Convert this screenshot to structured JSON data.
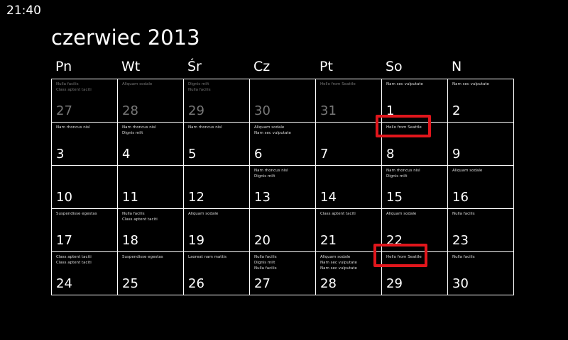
{
  "status_bar": {
    "time": "21:40"
  },
  "header": {
    "month_title": "czerwiec 2013"
  },
  "weekdays": [
    "Pn",
    "Wt",
    "Śr",
    "Cz",
    "Pt",
    "So",
    "N"
  ],
  "weeks": [
    [
      {
        "day": "27",
        "other": true,
        "events": [
          "Nulla facilis",
          "Class aptent taciti"
        ]
      },
      {
        "day": "28",
        "other": true,
        "events": [
          "Aliquam sodale"
        ]
      },
      {
        "day": "29",
        "other": true,
        "events": [
          "Dignis milt",
          "Nulla facilis"
        ]
      },
      {
        "day": "30",
        "other": true,
        "events": []
      },
      {
        "day": "31",
        "other": true,
        "events": [
          "Hello from Seattle"
        ]
      },
      {
        "day": "1",
        "other": false,
        "events": [
          "Nam sec vulputate"
        ]
      },
      {
        "day": "2",
        "other": false,
        "events": [
          "Nam sec vulputate"
        ]
      }
    ],
    [
      {
        "day": "3",
        "other": false,
        "events": [
          "Nam rhoncus nisl"
        ]
      },
      {
        "day": "4",
        "other": false,
        "events": [
          "Nam rhoncus nisl",
          "Dignis milt"
        ]
      },
      {
        "day": "5",
        "other": false,
        "events": [
          "Nam rhoncus nisl"
        ]
      },
      {
        "day": "6",
        "other": false,
        "events": [
          "Aliquam sodale",
          "Nam sec vulputate"
        ]
      },
      {
        "day": "7",
        "other": false,
        "events": []
      },
      {
        "day": "8",
        "other": false,
        "events": [
          "Hello from Seattle"
        ]
      },
      {
        "day": "9",
        "other": false,
        "events": []
      }
    ],
    [
      {
        "day": "10",
        "other": false,
        "events": []
      },
      {
        "day": "11",
        "other": false,
        "events": []
      },
      {
        "day": "12",
        "other": false,
        "events": []
      },
      {
        "day": "13",
        "other": false,
        "events": [
          "Nam rhoncus nisl",
          "Dignis milt"
        ]
      },
      {
        "day": "14",
        "other": false,
        "events": []
      },
      {
        "day": "15",
        "other": false,
        "events": [
          "Nam rhoncus nisl",
          "Dignis milt"
        ]
      },
      {
        "day": "16",
        "other": false,
        "events": [
          "Aliquam sodale"
        ]
      }
    ],
    [
      {
        "day": "17",
        "other": false,
        "events": [
          "Suspendisse egestas"
        ]
      },
      {
        "day": "18",
        "other": false,
        "events": [
          "Nulla facilis",
          "Class aptent taciti"
        ]
      },
      {
        "day": "19",
        "other": false,
        "events": [
          "Aliquam sodale"
        ]
      },
      {
        "day": "20",
        "other": false,
        "events": []
      },
      {
        "day": "21",
        "other": false,
        "events": [
          "Class aptent taciti"
        ]
      },
      {
        "day": "22",
        "other": false,
        "events": [
          "Aliquam sodale"
        ]
      },
      {
        "day": "23",
        "other": false,
        "events": [
          "Nulla facilis"
        ]
      }
    ],
    [
      {
        "day": "24",
        "other": false,
        "events": [
          "Class aptent taciti",
          "Class aptent taciti"
        ]
      },
      {
        "day": "25",
        "other": false,
        "events": [
          "Suspendisse egestas"
        ]
      },
      {
        "day": "26",
        "other": false,
        "events": [
          "Laoreat nam mattis"
        ]
      },
      {
        "day": "27",
        "other": false,
        "events": [
          "Nulla facilis",
          "Dignis milt",
          "Nulla facilis"
        ]
      },
      {
        "day": "28",
        "other": false,
        "events": [
          "Aliquam sodale",
          "Nam sec vulputate",
          "Nam sec vulputate"
        ]
      },
      {
        "day": "29",
        "other": false,
        "events": [
          "Hello from Seattle"
        ]
      },
      {
        "day": "30",
        "other": false,
        "events": [
          "Nulla facilis"
        ]
      }
    ]
  ],
  "highlight_color": "#e0161c",
  "highlighted_days": [
    "8",
    "29"
  ]
}
